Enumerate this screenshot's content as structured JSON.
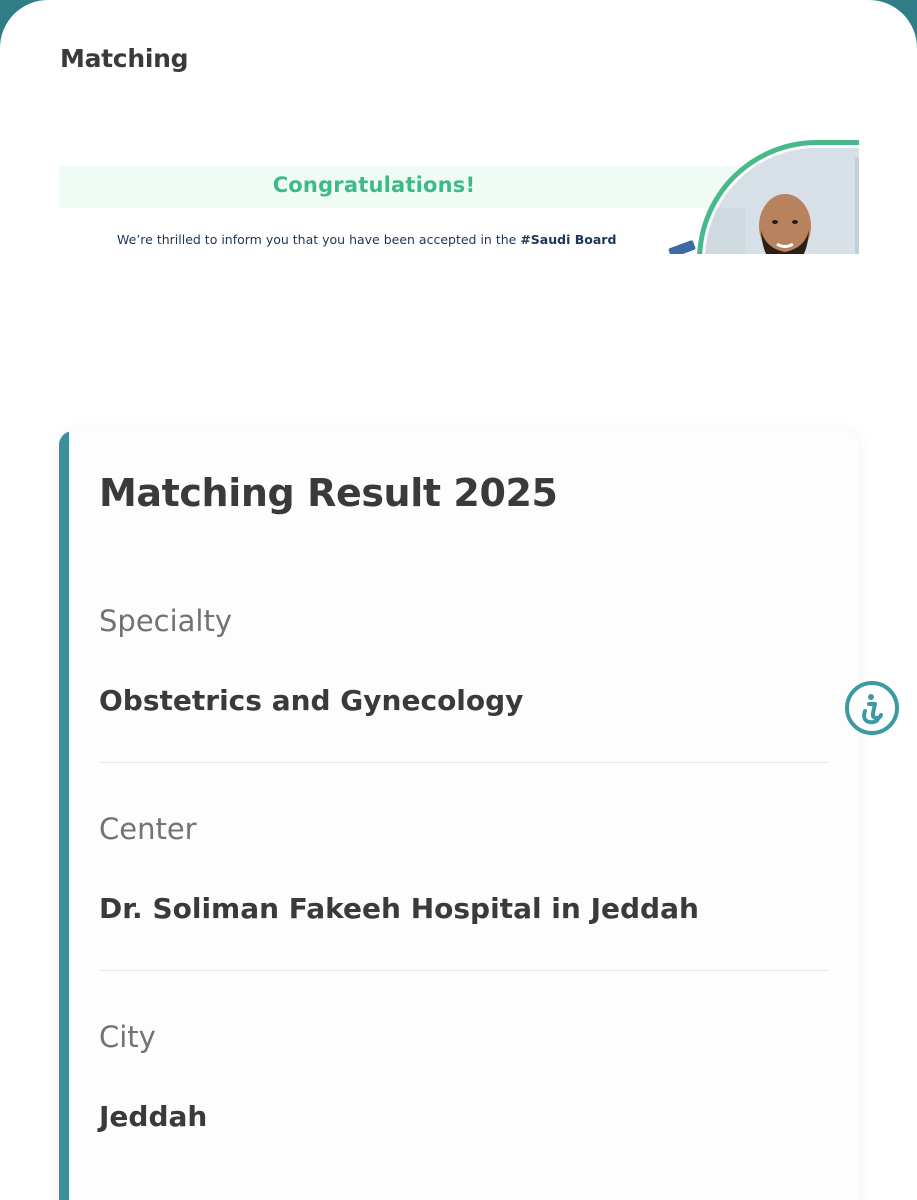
{
  "page": {
    "title": "Matching"
  },
  "banner": {
    "heading": "Congratulations!",
    "text_prefix": "We’re thrilled to inform you that you have been accepted in the ",
    "text_bold": "#Saudi Board"
  },
  "card": {
    "title": "Matching Result 2025",
    "fields": [
      {
        "label": "Specialty",
        "value": "Obstetrics and Gynecology"
      },
      {
        "label": "Center",
        "value": "Dr. Soliman Fakeeh Hospital in Jeddah"
      },
      {
        "label": "City",
        "value": "Jeddah"
      }
    ]
  },
  "colors": {
    "accent": "#3d8f9a",
    "banner_green": "#3dbb87",
    "text_dark": "#3a3a3c",
    "text_muted": "#6f7477"
  },
  "icons": {
    "help": "accessibility-help-icon"
  }
}
